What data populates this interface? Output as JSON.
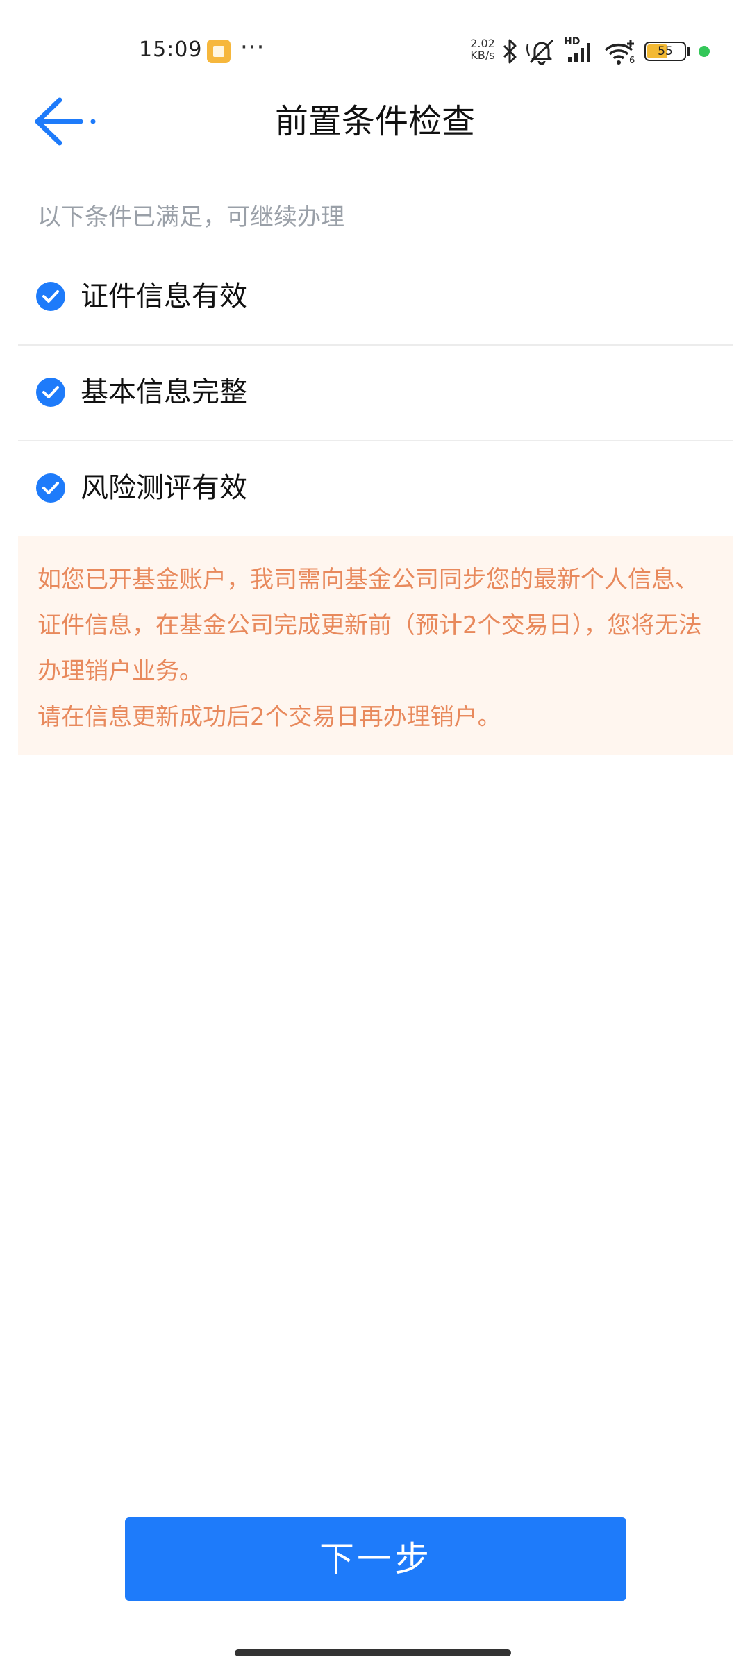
{
  "status_bar": {
    "time": "15:09",
    "more_dots": "···",
    "net_speed_value": "2.02",
    "net_speed_unit": "KB/s",
    "signal_label": "HD",
    "wifi_label": "6",
    "battery_level": "55",
    "battery_fraction": 0.55,
    "icons": [
      "note-app-icon",
      "bluetooth-icon",
      "mute-icon",
      "signal-icon",
      "wifi-icon",
      "battery-icon",
      "active-dot-icon"
    ],
    "colors": {
      "note_app": "#f6b73c",
      "battery_fill": "#f3b933",
      "active_dot": "#34c759"
    }
  },
  "header": {
    "back_icon": "arrow-left-icon",
    "title": "前置条件检查"
  },
  "main": {
    "subtitle": "以下条件已满足，可继续办理",
    "check_icon": "check-circle-icon",
    "conditions": [
      {
        "label": "证件信息有效"
      },
      {
        "label": "基本信息完整"
      },
      {
        "label": "风险测评有效"
      }
    ],
    "notice": {
      "paragraph1": "如您已开基金账户，我司需向基金公司同步您的最新个人信息、证件信息，在基金公司完成更新前（预计2个交易日），您将无法办理销户业务。",
      "paragraph2": "请在信息更新成功后2个交易日再办理销户。"
    }
  },
  "footer": {
    "next_label": "下一步"
  },
  "colors": {
    "accent": "#1e7bfa",
    "notice_text": "#e8895c",
    "notice_bg": "#fff6ef",
    "subtitle_text": "#9aa0a8"
  }
}
